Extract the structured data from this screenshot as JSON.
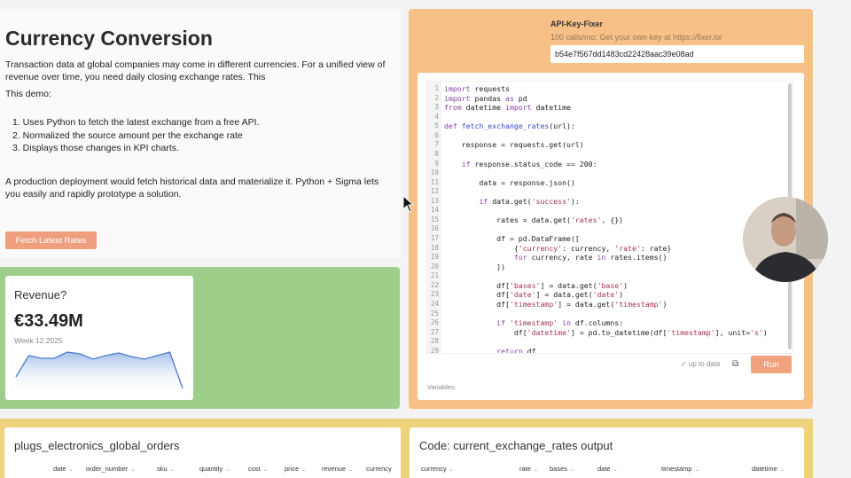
{
  "intro": {
    "title": "Currency Conversion",
    "p1": "Transaction data at global companies may come in different currencies. For a unified view of revenue over time, you need daily closing exchange rates. This",
    "p2": "This demo:",
    "list": [
      "1. Uses Python to fetch the latest exchange from a free API.",
      "2. Normalized the source amount per the exchange rate",
      "3. Displays those changes in KPI charts."
    ],
    "p3": "A production deployment would fetch historical data and materialize it. Python + Sigma lets you easily and rapidly prototype a solution.",
    "button": "Fetch Latest Rates"
  },
  "kpi": {
    "title": "Revenue?",
    "value": "€33.49M",
    "subtitle": "Week 12 2025"
  },
  "chart_data": {
    "type": "area",
    "title": "Revenue?",
    "categories": [],
    "values": [
      14,
      38,
      35,
      35,
      42,
      40,
      34,
      38,
      41,
      37,
      34,
      38,
      42,
      1
    ],
    "xlabel": "",
    "ylabel": "",
    "color": "#4a7bd0"
  },
  "api": {
    "label": "API-Key-Fixer",
    "help": "100 calls/mo. Get your own key at https://fixer.io/",
    "value": "b54e7f567dd1483cd22428aac39e08ad"
  },
  "code": {
    "lines": [
      "import requests",
      "import pandas as pd",
      "from datetime import datetime",
      "",
      "def fetch_exchange_rates(url):",
      "",
      "    response = requests.get(url)",
      "",
      "    if response.status_code == 200:",
      "",
      "        data = response.json()",
      "",
      "        if data.get('success'):",
      "",
      "            rates = data.get('rates', {})",
      "",
      "            df = pd.DataFrame([",
      "                {'currency': currency, 'rate': rate}",
      "                for currency, rate in rates.items()",
      "            ])",
      "",
      "            df['bases'] = data.get('base')",
      "            df['date'] = data.get('date')",
      "            df['timestamp'] = data.get('timestamp')",
      "",
      "            if 'timestamp' in df.columns:",
      "                df['datetime'] = pd.to_datetime(df['timestamp'], unit='s')",
      "",
      "            return df"
    ],
    "status": "✓ up to date",
    "run": "Run",
    "variables": "Variables:"
  },
  "tables": [
    {
      "title": "plugs_electronics_global_orders",
      "columns": [
        "date",
        "order_number",
        "sku",
        "quantity",
        "cost",
        "price",
        "revenue",
        "currency"
      ]
    },
    {
      "title": "Code: current_exchange_rates output",
      "columns": [
        "currency",
        "rate",
        "bases",
        "date",
        "timestamp",
        "datetime"
      ]
    }
  ],
  "colors": {
    "accent": "#ef9f7e",
    "green": "#9dcf8b",
    "orange": "#f6c087",
    "yellow": "#efd37c"
  }
}
